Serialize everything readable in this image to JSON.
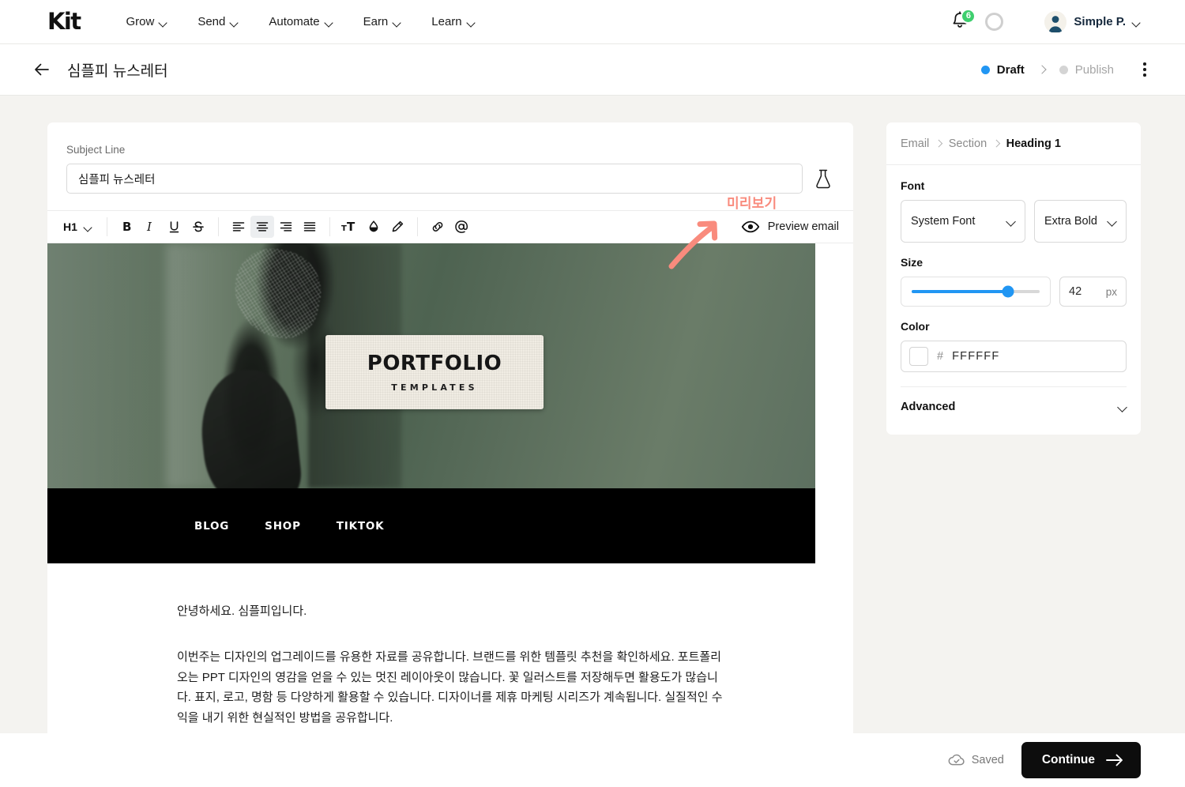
{
  "topnav": {
    "logo": "Kit",
    "items": [
      {
        "label": "Grow"
      },
      {
        "label": "Send"
      },
      {
        "label": "Automate"
      },
      {
        "label": "Earn"
      },
      {
        "label": "Learn"
      }
    ],
    "notification_count": "6",
    "user_name": "Simple P."
  },
  "subheader": {
    "title": "심플피 뉴스레터",
    "status_draft": "Draft",
    "status_publish": "Publish"
  },
  "editor": {
    "subject_label": "Subject Line",
    "subject_value": "심플피 뉴스레터",
    "subject_placeholder": "Subject Line",
    "toolbar": {
      "block_style": "H1",
      "bold": "B",
      "italic": "I",
      "underline": "U",
      "strike": "S",
      "preview_label": "Preview email"
    },
    "annotation": {
      "text": "미리보기",
      "color": "#F98B7D"
    },
    "hero": {
      "heading_text": "Heading 1",
      "tag_title": "PORTFOLIO",
      "tag_subtitle": "TEMPLATES"
    },
    "nav_links": [
      "BLOG",
      "SHOP",
      "TIKTOK"
    ],
    "paragraphs": [
      "안녕하세요. 심플피입니다.",
      "이번주는 디자인의 업그레이드를 유용한 자료를 공유합니다. 브랜드를 위한 템플릿 추천을 확인하세요. 포트폴리오는 PPT 디자인의 영감을 얻을 수 있는 멋진 레이아웃이 많습니다. 꽃 일러스트를 저장해두면 활용도가 많습니다. 표지, 로고, 명함 등 다양하게 활용할 수 있습니다. 디자이너를 제휴 마케팅 시리즈가 계속됩니다. 실질적인 수익을 내기 위한 현실적인 방법을 공유합니다."
    ]
  },
  "panel": {
    "breadcrumb": [
      "Email",
      "Section",
      "Heading 1"
    ],
    "font_label": "Font",
    "font_family": "System Font",
    "font_weight": "Extra Bold",
    "size_label": "Size",
    "size_value": "42",
    "size_unit": "px",
    "size_percent": 75,
    "color_label": "Color",
    "color_hash": "#",
    "color_hex": "FFFFFF",
    "color_swatch": "#FFFFFF",
    "advanced_label": "Advanced",
    "accent_color": "#2196F3"
  },
  "footer": {
    "saved_label": "Saved",
    "continue_label": "Continue"
  }
}
